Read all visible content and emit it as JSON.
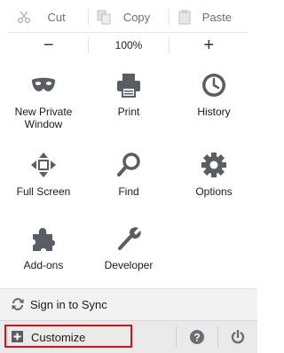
{
  "edit": {
    "cut": "Cut",
    "copy": "Copy",
    "paste": "Paste"
  },
  "zoom": {
    "out": "−",
    "level": "100%",
    "in": "+"
  },
  "tiles": [
    {
      "label": "New Private Window",
      "icon": "mask-icon"
    },
    {
      "label": "Print",
      "icon": "printer-icon"
    },
    {
      "label": "History",
      "icon": "clock-icon"
    },
    {
      "label": "Full Screen",
      "icon": "fullscreen-icon"
    },
    {
      "label": "Find",
      "icon": "magnifier-icon"
    },
    {
      "label": "Options",
      "icon": "gear-icon"
    },
    {
      "label": "Add-ons",
      "icon": "puzzle-icon"
    },
    {
      "label": "Developer",
      "icon": "wrench-icon"
    }
  ],
  "sync": {
    "label": "Sign in to Sync"
  },
  "footer": {
    "customize": "Customize",
    "help_icon": "help-icon",
    "quit_icon": "power-icon"
  },
  "colors": {
    "icon_gray": "#5a5d63",
    "highlight": "#d01418"
  }
}
